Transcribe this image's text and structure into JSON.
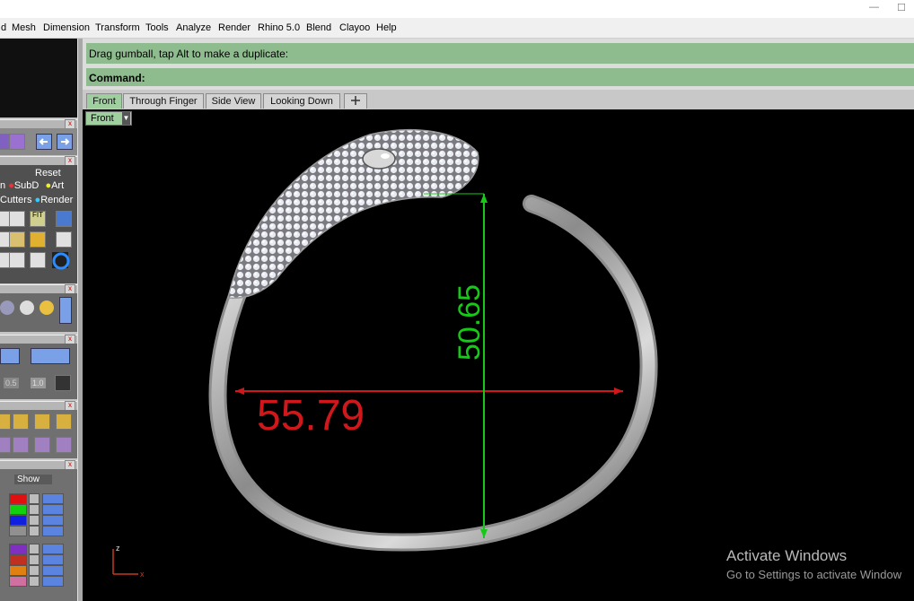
{
  "window": {
    "minimize": "—",
    "maximize": "☐"
  },
  "menubar": {
    "items": [
      "d",
      "Mesh",
      "Dimension",
      "Transform",
      "Tools",
      "Analyze",
      "Render",
      "Rhino 5.0",
      "Blend",
      "Clayoo",
      "Help"
    ]
  },
  "command": {
    "prompt_text": "Drag gumball, tap Alt to make a duplicate:",
    "label": "Command:",
    "value": ""
  },
  "viewport_tabs": [
    "Front",
    "Through Finger",
    "Side View",
    "Looking Down"
  ],
  "viewport": {
    "name": "Front",
    "width_dimension": "55.79",
    "height_dimension": "50.65",
    "axis_z": "z",
    "axis_x": "x"
  },
  "leftpanel": {
    "reset_label": "Reset",
    "row1": [
      "n",
      "SubD",
      "Art"
    ],
    "row2": [
      "Cutters",
      "Render"
    ],
    "fit_label": "FIT",
    "value_a": "0.5",
    "value_b": "1.0",
    "show_label": "Show",
    "layer_colors": [
      "#e01010",
      "#10d010",
      "#1020e0",
      "#909090",
      "#8030c0",
      "#c03020",
      "#e08010",
      "#d070a0"
    ]
  },
  "watermark": {
    "line1": "Activate Windows",
    "line2": "Go to Settings to activate Window"
  },
  "colors": {
    "command_green": "#8fbc8f",
    "dim_red": "#d0181c",
    "dim_green": "#18c818"
  }
}
